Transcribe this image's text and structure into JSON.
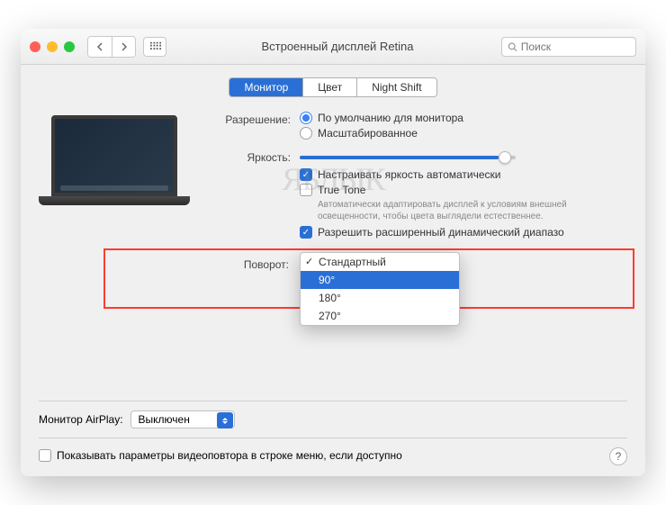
{
  "window": {
    "title": "Встроенный дисплей Retina",
    "search_placeholder": "Поиск"
  },
  "tabs": {
    "monitor": "Монитор",
    "color": "Цвет",
    "night_shift": "Night Shift"
  },
  "labels": {
    "resolution": "Разрешение:",
    "brightness": "Яркость:",
    "rotation": "Поворот:"
  },
  "resolution": {
    "default": "По умолчанию для монитора",
    "scaled": "Масштабированное"
  },
  "options": {
    "auto_brightness": "Настраивать яркость автоматически",
    "true_tone": "True Tone",
    "true_tone_desc": "Автоматически адаптировать дисплей к условиям внешней освещенности, чтобы цвета выглядели естественнее.",
    "hdr": "Разрешить расширенный динамический диапазо"
  },
  "rotation": {
    "items": [
      "Стандартный",
      "90°",
      "180°",
      "270°"
    ],
    "selected": 1,
    "checked": 0
  },
  "footer": {
    "airplay_label": "Монитор AirPlay:",
    "airplay_value": "Выключен",
    "show_mirroring": "Показывать параметры видеоповтора в строке меню, если доступно"
  },
  "watermark": "ЯБЛЫК"
}
